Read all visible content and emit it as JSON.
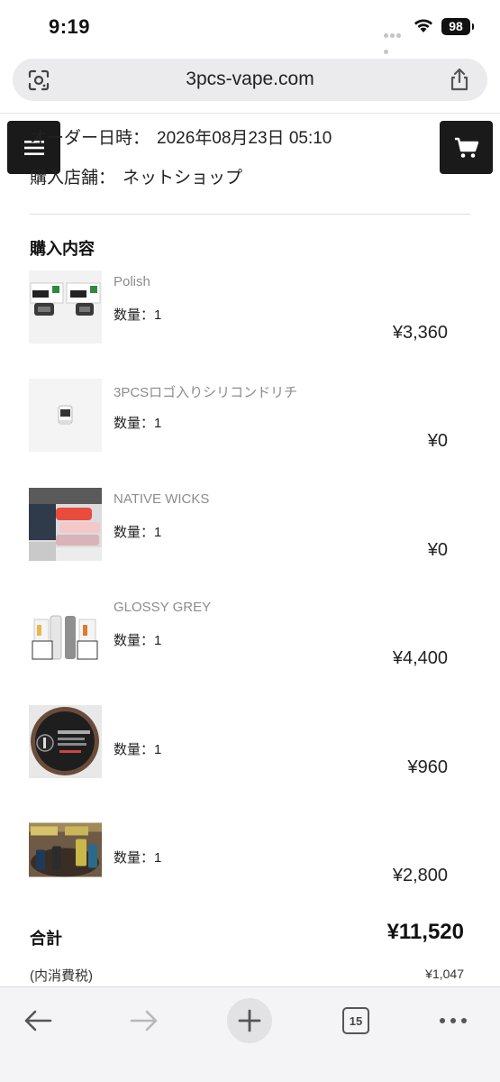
{
  "status_bar": {
    "time": "9:19",
    "battery": "98"
  },
  "browser": {
    "url": "3pcs-vape.com",
    "tab_count": "15"
  },
  "order": {
    "date_label": "オーダー日時：",
    "date_value": "2026年08月23日 05:10",
    "store_label": "購入店舗：",
    "store_value": "ネットショップ"
  },
  "purchase": {
    "title": "購入内容",
    "items": [
      {
        "name": "Polish",
        "qty": "数量：1",
        "price": "¥3,360"
      },
      {
        "name": "3PCSロゴ入りシリコンドリチ",
        "qty": "数量：1",
        "price": "¥0"
      },
      {
        "name": "NATIVE WICKS",
        "qty": "数量：1",
        "price": "¥0"
      },
      {
        "name": "GLOSSY GREY",
        "qty": "数量：1",
        "price": "¥4,400"
      },
      {
        "name": "",
        "qty": "数量：1",
        "price": "¥960"
      },
      {
        "name": "",
        "qty": "数量：1",
        "price": "¥2,800"
      }
    ]
  },
  "totals": {
    "total_label": "合計",
    "total_value": "¥11,520",
    "tax_label": "(内消費税)",
    "tax_value": "¥1,047"
  },
  "colors": {
    "button_dark": "#1a1a1a",
    "muted_text": "#8c8c8c"
  }
}
